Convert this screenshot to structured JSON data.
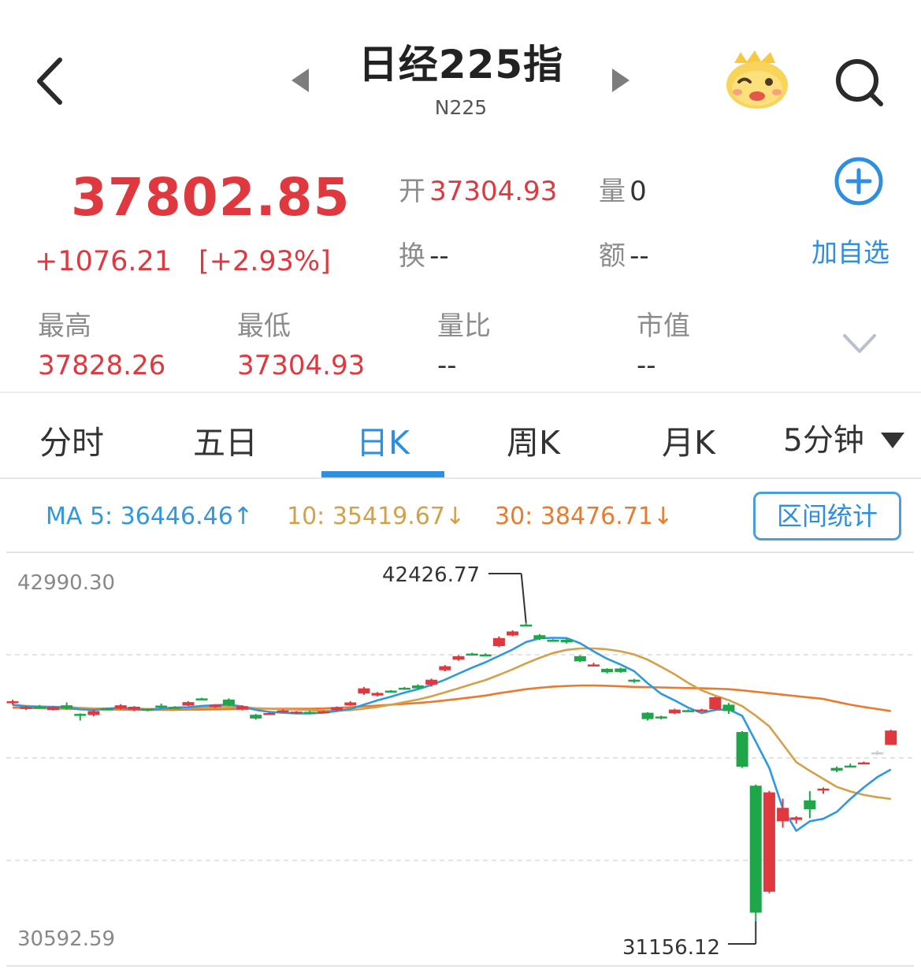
{
  "header": {
    "title": "日经225指",
    "subtitle": "N225",
    "back_icon": "chevron-left-icon",
    "prev_icon": "caret-left-icon",
    "next_icon": "caret-right-icon",
    "mascot_icon": "mascot-icon",
    "search_icon": "search-icon"
  },
  "quote": {
    "price": "37802.85",
    "change": "+1076.21",
    "change_pct": "[+2.93%]",
    "open_label": "开",
    "open_value": "37304.93",
    "volume_label": "量",
    "volume_value": "0",
    "turnover_label": "换",
    "turnover_value": "--",
    "amount_label": "额",
    "amount_value": "--",
    "add_watch_label": "加自选",
    "high_label": "最高",
    "high_value": "37828.26",
    "low_label": "最低",
    "low_value": "37304.93",
    "vol_ratio_label": "量比",
    "vol_ratio_value": "--",
    "mkt_cap_label": "市值",
    "mkt_cap_value": "--",
    "colors": {
      "up": "#e0383f",
      "down": "#1fa64a",
      "accent": "#2e8ee0"
    }
  },
  "tabs": {
    "items": [
      "分时",
      "五日",
      "日K",
      "周K",
      "月K",
      "5分钟"
    ],
    "active": "日K"
  },
  "ma_legend": {
    "ma5": "MA 5: 36446.46↑",
    "ma10": "10: 35419.67↓",
    "ma30": "30: 38476.71↓",
    "range_button": "区间统计"
  },
  "chart_data": {
    "type": "candlestick",
    "y_axis_top_label": "42990.30",
    "y_axis_bottom_label": "30592.59",
    "ylim": [
      30592.59,
      42990.3
    ],
    "max_marker": "42426.77",
    "min_marker": "31156.12",
    "colors": {
      "up": "#e0383f",
      "down": "#1fa64a",
      "pending": "#c8ccd4",
      "ma5": "#2e98e0",
      "ma10": "#d4a04a",
      "ma30": "#ea7a2c"
    },
    "candles": [
      [
        38770,
        38820,
        38700,
        38870,
        "r"
      ],
      [
        38620,
        38560,
        38520,
        38660,
        "r"
      ],
      [
        38640,
        38640,
        38600,
        38690,
        "g"
      ],
      [
        38620,
        38520,
        38500,
        38650,
        "r"
      ],
      [
        38680,
        38570,
        38520,
        38780,
        "g"
      ],
      [
        38380,
        38360,
        38150,
        38400,
        "g"
      ],
      [
        38340,
        38480,
        38300,
        38540,
        "r"
      ],
      [
        38550,
        38580,
        38520,
        38600,
        "g"
      ],
      [
        38560,
        38680,
        38530,
        38720,
        "r"
      ],
      [
        38630,
        38530,
        38480,
        38650,
        "r"
      ],
      [
        38560,
        38500,
        38470,
        38580,
        "g"
      ],
      [
        38600,
        38670,
        38580,
        38740,
        "g"
      ],
      [
        38610,
        38620,
        38570,
        38650,
        "g"
      ],
      [
        38670,
        38790,
        38650,
        38820,
        "r"
      ],
      [
        38910,
        38920,
        38900,
        38940,
        "g"
      ],
      [
        38700,
        38620,
        38590,
        38720,
        "r"
      ],
      [
        38880,
        38680,
        38650,
        38920,
        "g"
      ],
      [
        38650,
        38530,
        38500,
        38680,
        "r"
      ],
      [
        38350,
        38220,
        38180,
        38380,
        "g"
      ],
      [
        38400,
        38410,
        38380,
        38450,
        "r"
      ],
      [
        38480,
        38500,
        38460,
        38540,
        "r"
      ],
      [
        38460,
        38410,
        38380,
        38480,
        "r"
      ],
      [
        38450,
        38410,
        38380,
        38480,
        "g"
      ],
      [
        38460,
        38470,
        38440,
        38500,
        "r"
      ],
      [
        38510,
        38610,
        38490,
        38640,
        "r"
      ],
      [
        38680,
        38780,
        38660,
        38820,
        "r"
      ],
      [
        39090,
        39270,
        39040,
        39320,
        "r"
      ],
      [
        39020,
        39110,
        38990,
        39140,
        "r"
      ],
      [
        39170,
        39190,
        39140,
        39210,
        "g"
      ],
      [
        39250,
        39290,
        39220,
        39320,
        "g"
      ],
      [
        39370,
        39270,
        39240,
        39410,
        "g"
      ],
      [
        39400,
        39570,
        39330,
        39610,
        "r"
      ],
      [
        39900,
        40040,
        39860,
        40080,
        "r"
      ],
      [
        40270,
        40390,
        40230,
        40420,
        "r"
      ],
      [
        40470,
        40480,
        40450,
        40510,
        "g"
      ],
      [
        40440,
        40450,
        40410,
        40490,
        "g"
      ],
      [
        40740,
        41020,
        40700,
        41080,
        "r"
      ],
      [
        41110,
        41250,
        41080,
        41290,
        "r"
      ],
      [
        41470,
        41490,
        41450,
        41560,
        "g"
      ],
      [
        41120,
        40990,
        40950,
        41160,
        "g"
      ],
      [
        40940,
        40960,
        40920,
        40980,
        "g"
      ],
      [
        40960,
        40870,
        40830,
        41000,
        "g"
      ],
      [
        40390,
        40210,
        40180,
        40420,
        "g"
      ],
      [
        40100,
        40070,
        40030,
        40160,
        "r"
      ],
      [
        39950,
        39830,
        39790,
        39970,
        "g"
      ],
      [
        39960,
        39840,
        39810,
        39990,
        "g"
      ],
      [
        39570,
        39500,
        39460,
        39600,
        "g"
      ],
      [
        38420,
        38200,
        38150,
        38440,
        "g"
      ],
      [
        38240,
        38290,
        38190,
        38320,
        "g"
      ],
      [
        38400,
        38530,
        38370,
        38560,
        "r"
      ],
      [
        38510,
        38500,
        38460,
        38540,
        "g"
      ],
      [
        38530,
        38490,
        38460,
        38560,
        "r"
      ],
      [
        38960,
        38540,
        38500,
        38980,
        "r"
      ],
      [
        38700,
        38480,
        38380,
        38760,
        "g"
      ],
      [
        37750,
        36540,
        36500,
        37780,
        "g"
      ],
      [
        35880,
        31460,
        31156,
        35920,
        "g"
      ],
      [
        35650,
        32190,
        32140,
        35700,
        "r"
      ],
      [
        35110,
        34640,
        34420,
        35430,
        "r"
      ],
      [
        34780,
        34690,
        34560,
        34820,
        "r"
      ],
      [
        35060,
        35370,
        34750,
        35690,
        "g"
      ],
      [
        35750,
        35780,
        35600,
        35820,
        "r"
      ],
      [
        36400,
        36500,
        36350,
        36550,
        "g"
      ],
      [
        36570,
        36580,
        36550,
        36650,
        "g"
      ],
      [
        36650,
        36690,
        36640,
        36720,
        "r"
      ],
      [
        37000,
        37040,
        36950,
        37100,
        "p"
      ],
      [
        37300,
        37800,
        37300,
        37830,
        "r"
      ]
    ],
    "ma5": [
      38700,
      38640,
      38610,
      38620,
      38600,
      38540,
      38520,
      38560,
      38600,
      38560,
      38520,
      38570,
      38600,
      38610,
      38660,
      38680,
      38700,
      38640,
      38520,
      38450,
      38420,
      38400,
      38400,
      38420,
      38480,
      38550,
      38700,
      38850,
      38980,
      39120,
      39240,
      39390,
      39570,
      39780,
      39990,
      40180,
      40400,
      40620,
      40880,
      41010,
      41030,
      41020,
      40840,
      40560,
      40300,
      40100,
      39870,
      39450,
      39080,
      38850,
      38600,
      38410,
      38520,
      38540,
      38310,
      37420,
      36500,
      35100,
      34310,
      34640,
      34730,
      34970,
      35420,
      35820,
      36180,
      36446
    ],
    "ma10": [
      38690,
      38660,
      38640,
      38630,
      38620,
      38590,
      38570,
      38570,
      38580,
      38570,
      38550,
      38560,
      38570,
      38580,
      38600,
      38610,
      38620,
      38610,
      38580,
      38560,
      38540,
      38530,
      38510,
      38490,
      38500,
      38510,
      38560,
      38620,
      38700,
      38790,
      38880,
      38990,
      39130,
      39270,
      39420,
      39560,
      39740,
      39930,
      40140,
      40330,
      40500,
      40610,
      40660,
      40660,
      40630,
      40560,
      40450,
      40270,
      40020,
      39760,
      39460,
      39200,
      39020,
      38860,
      38650,
      38320,
      37950,
      37330,
      36700,
      36400,
      36120,
      35840,
      35680,
      35560,
      35480,
      35420
    ],
    "ma30": [
      38600,
      38590,
      38580,
      38570,
      38560,
      38550,
      38540,
      38530,
      38530,
      38520,
      38520,
      38520,
      38520,
      38530,
      38530,
      38540,
      38550,
      38560,
      38560,
      38560,
      38560,
      38560,
      38560,
      38570,
      38590,
      38610,
      38640,
      38670,
      38700,
      38730,
      38760,
      38800,
      38850,
      38900,
      38960,
      39020,
      39100,
      39170,
      39240,
      39290,
      39330,
      39350,
      39370,
      39370,
      39360,
      39340,
      39320,
      39310,
      39300,
      39290,
      39280,
      39270,
      39260,
      39240,
      39200,
      39150,
      39100,
      39050,
      39000,
      38950,
      38900,
      38800,
      38700,
      38620,
      38550,
      38477
    ]
  }
}
